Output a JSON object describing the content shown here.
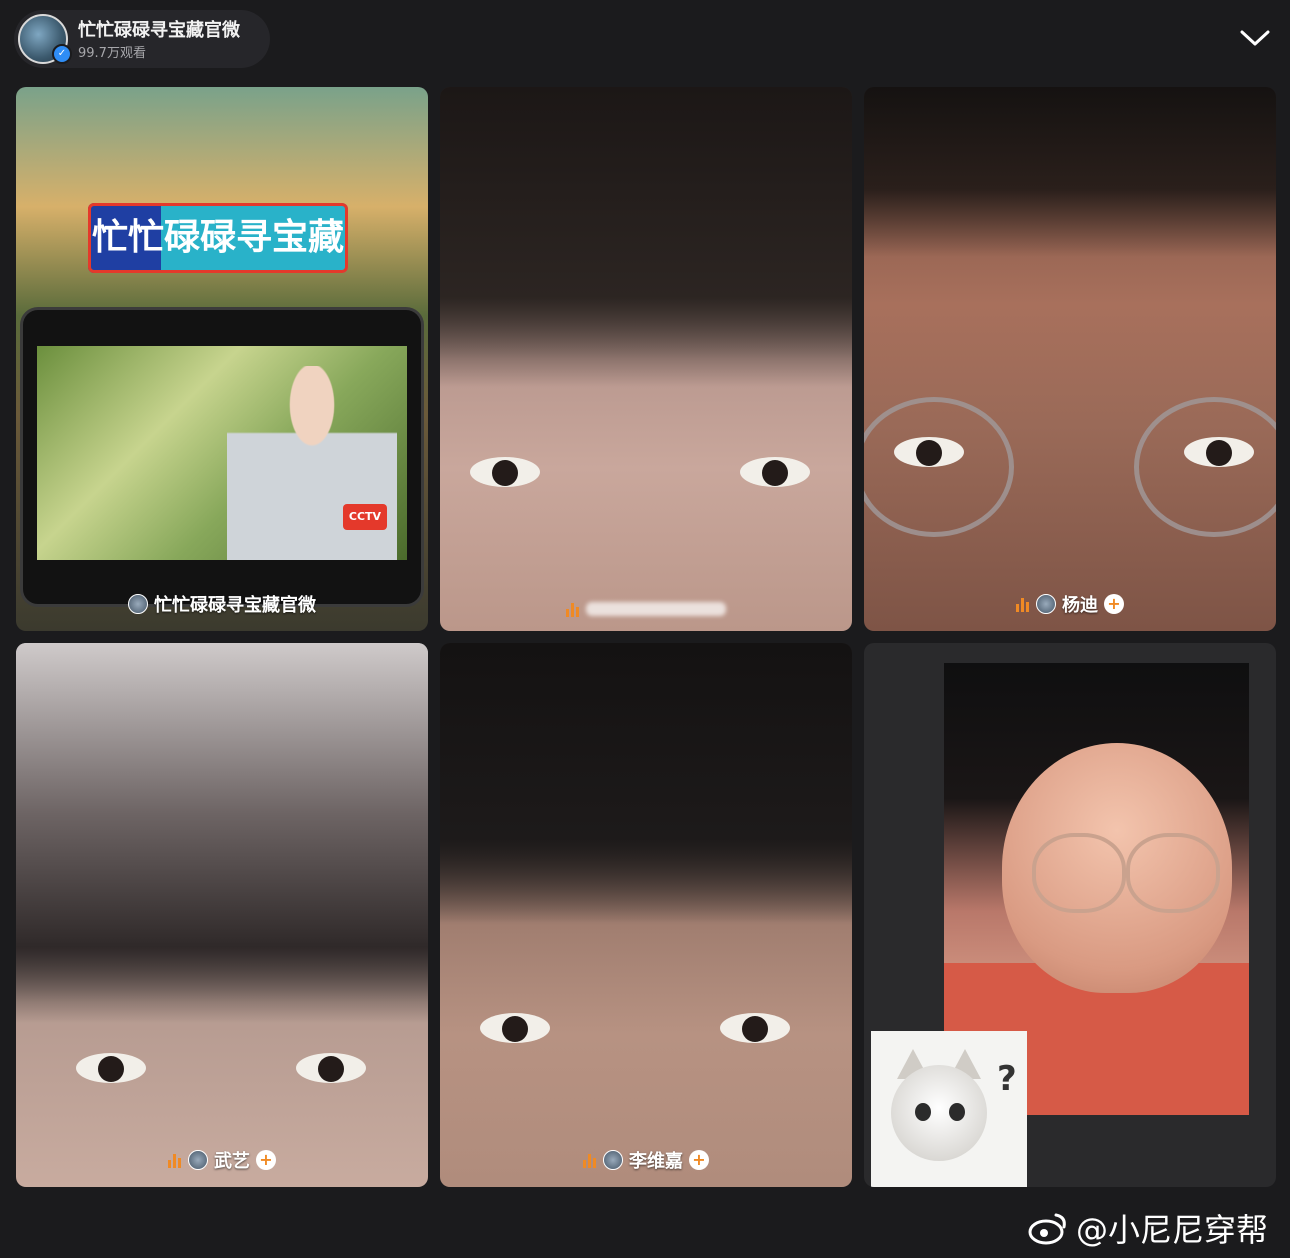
{
  "header": {
    "host_name": "忙忙碌碌寻宝藏官微",
    "viewers": "99.7万观看",
    "collapse_icon": "chevron-down-icon"
  },
  "tiles": [
    {
      "label": "忙忙碌碌寻宝藏官微",
      "poster_text": "忙忙碌碌寻宝藏",
      "screen_badge": "CCTV"
    },
    {
      "label": ""
    },
    {
      "label": "杨迪"
    },
    {
      "label": "武艺"
    },
    {
      "label": "李维嘉"
    },
    {
      "sticker_text": "?"
    }
  ],
  "watermark": {
    "text": "@小尼尼穿帮",
    "icon": "weibo-icon"
  },
  "colors": {
    "background": "#1b1b1d",
    "accent_orange": "#f08a24",
    "verified_blue": "#2f8df5"
  }
}
